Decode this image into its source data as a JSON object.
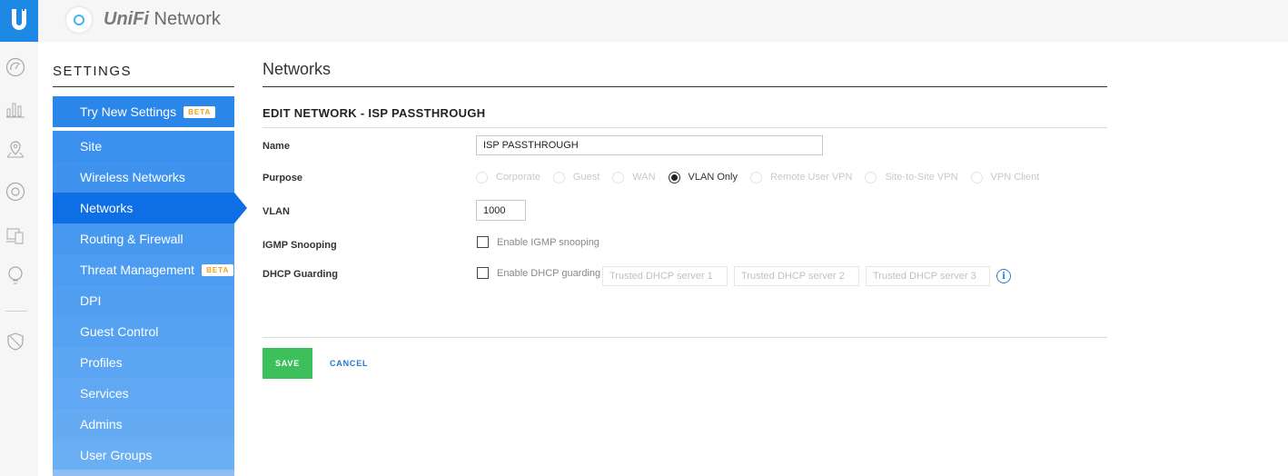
{
  "app": {
    "brand_prefix": "UniFi",
    "brand_suffix": " Network"
  },
  "rail_icons": [
    "dashboard-icon",
    "statistics-icon",
    "map-icon",
    "devices-icon",
    "clients-icon",
    "insights-icon",
    "alerts-shield-icon"
  ],
  "sidebar": {
    "title": "SETTINGS",
    "try_new": {
      "label": "Try New Settings",
      "badge": "BETA"
    },
    "items": [
      {
        "label": "Site"
      },
      {
        "label": "Wireless Networks"
      },
      {
        "label": "Networks",
        "active": true
      },
      {
        "label": "Routing & Firewall"
      },
      {
        "label": "Threat Management",
        "badge": "BETA"
      },
      {
        "label": "DPI"
      },
      {
        "label": "Guest Control"
      },
      {
        "label": "Profiles"
      },
      {
        "label": "Services"
      },
      {
        "label": "Admins"
      },
      {
        "label": "User Groups"
      }
    ],
    "colors": [
      "#3b90ef",
      "#3f93ef",
      "#0d6ee6",
      "#4799f0",
      "#4c9cf1",
      "#519ff1",
      "#56a2f2",
      "#5ba5f2",
      "#60a8f3",
      "#65abf3",
      "#6aaef4"
    ]
  },
  "main": {
    "page_title": "Networks",
    "form_title": "EDIT NETWORK - ISP PASSTHROUGH",
    "name_label": "Name",
    "name_value": "ISP PASSTHROUGH",
    "purpose_label": "Purpose",
    "purpose_options": [
      {
        "label": "Corporate",
        "selected": false
      },
      {
        "label": "Guest",
        "selected": false
      },
      {
        "label": "WAN",
        "selected": false
      },
      {
        "label": "VLAN Only",
        "selected": true
      },
      {
        "label": "Remote User VPN",
        "selected": false
      },
      {
        "label": "Site-to-Site VPN",
        "selected": false
      },
      {
        "label": "VPN Client",
        "selected": false
      }
    ],
    "vlan_label": "VLAN",
    "vlan_value": "1000",
    "igmp_label": "IGMP Snooping",
    "igmp_checkbox_label": "Enable IGMP snooping",
    "igmp_checked": false,
    "dhcp_label": "DHCP Guarding",
    "dhcp_checkbox_label": "Enable DHCP guarding",
    "dhcp_checked": false,
    "dhcp_server_placeholders": [
      "Trusted DHCP server 1",
      "Trusted DHCP server 2",
      "Trusted DHCP server 3"
    ],
    "info_glyph": "i",
    "save_label": "SAVE",
    "cancel_label": "CANCEL"
  },
  "colors": {
    "accent": "#1e88e5",
    "save": "#3dbf5c",
    "link": "#1f7ad0"
  }
}
